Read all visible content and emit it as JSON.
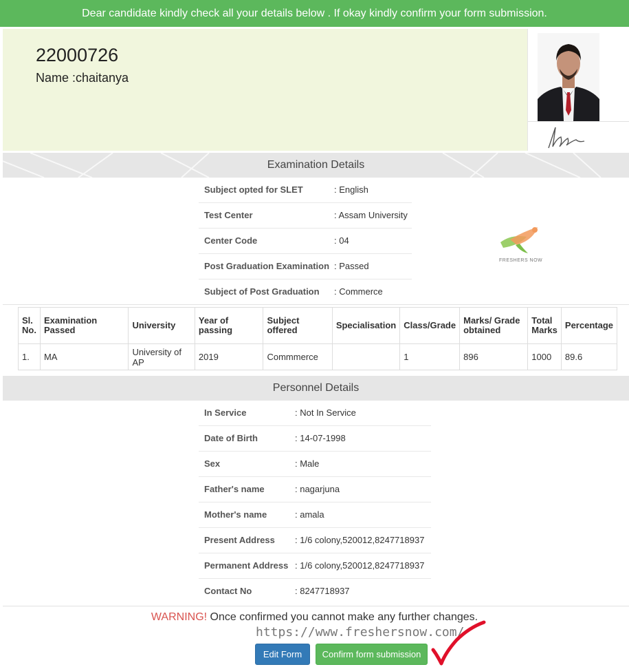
{
  "banner": {
    "text": "Dear candidate kindly check all your details below . If okay kindly confirm your form submission."
  },
  "candidate": {
    "application_no": "22000726",
    "name_line": "Name :chaitanya"
  },
  "exam_section": {
    "title": "Examination Details",
    "rows": [
      {
        "label": "Subject opted for SLET",
        "value": ": English"
      },
      {
        "label": "Test Center",
        "value": ": Assam University"
      },
      {
        "label": "Center Code",
        "value": ": 04"
      },
      {
        "label": "Post Graduation Examination",
        "value": ": Passed"
      },
      {
        "label": "Subject of Post Graduation",
        "value": ": Commerce"
      }
    ]
  },
  "watermark_logo": {
    "text": "FRESHERS NOW"
  },
  "qualification_table": {
    "headers": [
      "Sl. No.",
      "Examination Passed",
      "University",
      "Year of passing",
      "Subject offered",
      "Specialisation",
      "Class/Grade",
      "Marks/ Grade obtained",
      "Total Marks",
      "Percentage"
    ],
    "rows": [
      [
        "1.",
        "MA",
        "University of AP",
        "2019",
        "Commmerce",
        "",
        "1",
        "896",
        "1000",
        "89.6"
      ]
    ]
  },
  "personnel_section": {
    "title": "Personnel Details",
    "rows": [
      {
        "label": "In Service",
        "value": ": Not In Service"
      },
      {
        "label": "Date of Birth",
        "value": ": 14-07-1998"
      },
      {
        "label": "Sex",
        "value": ": Male"
      },
      {
        "label": "Father's name",
        "value": ": nagarjuna"
      },
      {
        "label": "Mother's name",
        "value": ": amala"
      },
      {
        "label": "Present Address",
        "value": ": 1/6 colony,520012,8247718937"
      },
      {
        "label": "Permanent Address",
        "value": ": 1/6 colony,520012,8247718937"
      },
      {
        "label": "Contact No",
        "value": ": 8247718937"
      }
    ]
  },
  "footer": {
    "warning_label": "WARNING!",
    "warning_text": " Once confirmed you cannot make any further changes.",
    "site_watermark": "https://www.freshersnow.com/",
    "edit_button": "Edit Form",
    "confirm_button": "Confirm form submission"
  },
  "colors": {
    "banner_green": "#5cb85c",
    "header_panel": "#f1f6dd",
    "warning_red": "#d9534f",
    "edit_blue": "#337ab7",
    "annotation_red": "#e0102a"
  }
}
